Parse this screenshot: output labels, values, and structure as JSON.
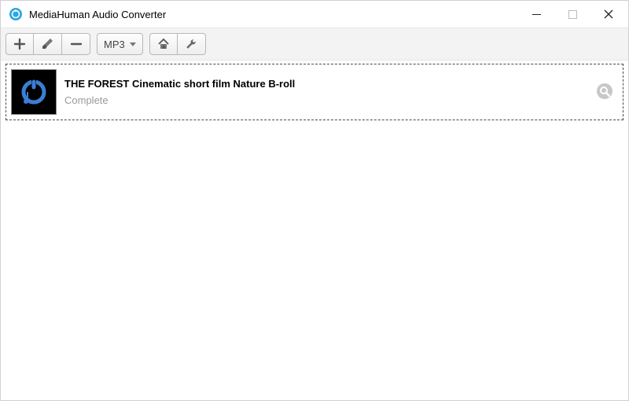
{
  "window": {
    "title": "MediaHuman Audio Converter"
  },
  "toolbar": {
    "format_label": "MP3",
    "icons": {
      "add": "plus-icon",
      "clear": "brush-icon",
      "remove": "minus-icon",
      "home": "home-icon",
      "settings": "wrench-icon"
    }
  },
  "items": [
    {
      "title": "THE FOREST Cinematic short film Nature B-roll",
      "status": "Complete"
    }
  ]
}
